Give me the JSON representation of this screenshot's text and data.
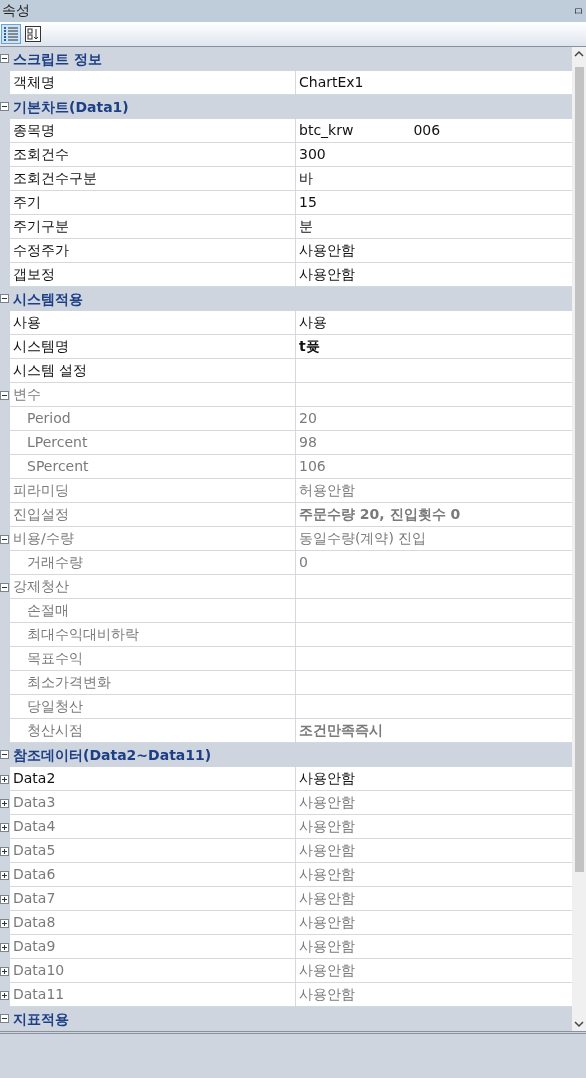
{
  "panel": {
    "title": "속성",
    "pin": "ㅁ"
  },
  "toolbar": [
    {
      "kind": "categorized",
      "selected": true
    },
    {
      "kind": "alphabetical",
      "selected": false
    }
  ],
  "categories": [
    {
      "label": "스크립트 정보",
      "expanded": true,
      "properties": [
        {
          "name": "객체명",
          "value": "ChartEx1",
          "disabled": false,
          "bold": false
        }
      ]
    },
    {
      "label": "기본차트(Data1)",
      "expanded": true,
      "properties": [
        {
          "name": "종목명",
          "value": "btc_krw",
          "suffix": "006",
          "disabled": false,
          "bold": false
        },
        {
          "name": "조회건수",
          "value": "300",
          "disabled": false,
          "bold": false
        },
        {
          "name": "조회건수구분",
          "value": "바",
          "disabled": false,
          "bold": false
        },
        {
          "name": "주기",
          "value": "15",
          "disabled": false,
          "bold": false
        },
        {
          "name": "주기구분",
          "value": "분",
          "disabled": false,
          "bold": false
        },
        {
          "name": "수정주가",
          "value": "사용안함",
          "disabled": false,
          "bold": false
        },
        {
          "name": "갭보정",
          "value": "사용안함",
          "disabled": false,
          "bold": false
        }
      ]
    },
    {
      "label": "시스템적용",
      "expanded": true,
      "properties": [
        {
          "name": "사용",
          "value": "사용",
          "disabled": false,
          "bold": false
        },
        {
          "name": "시스템명",
          "value": "t퓻",
          "disabled": false,
          "bold": true
        },
        {
          "name": "시스템 설정",
          "disabled": false
        },
        {
          "name": "변수",
          "disabled": true,
          "expanded": true,
          "children": [
            {
              "name": "Period",
              "value": "20",
              "disabled": true,
              "bold": false
            },
            {
              "name": "LPercent",
              "value": "98",
              "disabled": true,
              "bold": false
            },
            {
              "name": "SPercent",
              "value": "106",
              "disabled": true,
              "bold": false
            }
          ]
        },
        {
          "name": "피라미딩",
          "value": "허용안함",
          "disabled": true,
          "bold": false
        },
        {
          "name": "진입설정",
          "value": "주문수량 20, 진입횟수 0",
          "disabled": true,
          "bold": true
        },
        {
          "name": "비용/수량",
          "value": "동일수량(계약) 진입",
          "disabled": true,
          "bold": false,
          "expanded": true,
          "children": [
            {
              "name": "거래수량",
              "value": "0",
              "disabled": true,
              "bold": false
            }
          ]
        },
        {
          "name": "강제청산",
          "disabled": true,
          "expanded": true,
          "children": [
            {
              "name": "손절매",
              "disabled": true
            },
            {
              "name": "최대수익대비하락",
              "disabled": true
            },
            {
              "name": "목표수익",
              "disabled": true
            },
            {
              "name": "최소가격변화",
              "disabled": true
            },
            {
              "name": "당일청산",
              "disabled": true
            },
            {
              "name": "청산시점",
              "value": "조건만족즉시",
              "disabled": true,
              "bold": true
            }
          ]
        }
      ]
    },
    {
      "label": "참조데이터(Data2~Data11)",
      "expanded": true,
      "properties": [
        {
          "name": "Data2",
          "value": "사용안함",
          "disabled": false,
          "bold": false,
          "expanded": false
        },
        {
          "name": "Data3",
          "value": "사용안함",
          "disabled": true,
          "bold": false,
          "expanded": false
        },
        {
          "name": "Data4",
          "value": "사용안함",
          "disabled": true,
          "bold": false,
          "expanded": false
        },
        {
          "name": "Data5",
          "value": "사용안함",
          "disabled": true,
          "bold": false,
          "expanded": false
        },
        {
          "name": "Data6",
          "value": "사용안함",
          "disabled": true,
          "bold": false,
          "expanded": false
        },
        {
          "name": "Data7",
          "value": "사용안함",
          "disabled": true,
          "bold": false,
          "expanded": false
        },
        {
          "name": "Data8",
          "value": "사용안함",
          "disabled": true,
          "bold": false,
          "expanded": false
        },
        {
          "name": "Data9",
          "value": "사용안함",
          "disabled": true,
          "bold": false,
          "expanded": false
        },
        {
          "name": "Data10",
          "value": "사용안함",
          "disabled": true,
          "bold": false,
          "expanded": false
        },
        {
          "name": "Data11",
          "value": "사용안함",
          "disabled": true,
          "bold": false,
          "expanded": false
        }
      ]
    },
    {
      "label": "지표적용",
      "expanded": true
    }
  ]
}
